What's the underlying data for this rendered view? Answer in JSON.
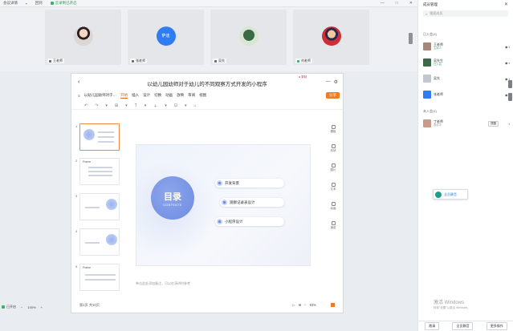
{
  "topbar": {
    "meeting_label": "会议详情",
    "dot": "▪",
    "gallery_label": "回到",
    "recording_label": "云录制已开启"
  },
  "window_controls": [
    "—",
    "□",
    "✕"
  ],
  "participants": [
    {
      "name": "王老师",
      "avatar": "photo"
    },
    {
      "name": "张老师",
      "avatar": "萨迪"
    },
    {
      "name": "吴先",
      "avatar": "plant"
    },
    {
      "name": "刘老师",
      "avatar": "cartoon"
    }
  ],
  "share": {
    "title": "以幼儿园幼师对于幼儿的不同观察方式开发的小程序",
    "rec_indicator": "● 录制",
    "ribbon": {
      "doc_name": "以幼儿园幼师对于…",
      "tabs": [
        "开始",
        "插入",
        "设计",
        "切换",
        "动画",
        "放映",
        "审阅",
        "视图"
      ],
      "active_tab": "开始",
      "share_button": "分享"
    },
    "toolrow": [
      "↶",
      "↷",
      "▾",
      "⊞",
      "▾",
      "T",
      "▾",
      "＋",
      "▾",
      "⊡",
      "▾",
      "⌂"
    ],
    "thumbnails": [
      {
        "num": "1",
        "name": ""
      },
      {
        "num": "2",
        "name": "Frame"
      },
      {
        "num": "3",
        "name": ""
      },
      {
        "num": "4",
        "name": ""
      },
      {
        "num": "5",
        "name": "Frame"
      }
    ],
    "slide": {
      "heading": "目录",
      "subheading": "CONTENTS",
      "items": [
        "开发背景",
        "观察记录表设计",
        "小程序设计"
      ]
    },
    "right_tools": [
      "模板",
      "形状",
      "图片",
      "文本",
      "动画",
      "演讲"
    ],
    "notes_placeholder": "单击此处添加备注，可以在演讲时参考",
    "status": {
      "slide_count": "第1页 共10页",
      "zoom": "93%"
    }
  },
  "bottom_left": {
    "status_label": "已开启",
    "zoom_label": "100%",
    "plus": "+"
  },
  "panel": {
    "title": "成员管理",
    "search_placeholder": "搜索成员",
    "section_online": "已入会(4)",
    "members": [
      {
        "name": "王老师",
        "sub": "主持人",
        "color": "#a7877a"
      },
      {
        "name": "吴先生",
        "sub": "已入会",
        "color": "#3b6b44"
      },
      {
        "name": "吴先",
        "sub": "",
        "color": "#c2c7cf"
      },
      {
        "name": "张老师",
        "sub": "",
        "color": "#2f7df2"
      }
    ],
    "section_pending": "未入会(1)",
    "pending": [
      {
        "name": "丁老师",
        "sub": "邀请中",
        "button": "提醒",
        "color": "#c99a87"
      }
    ],
    "float_button": "全员静音",
    "watermark_line1": "激活 Windows",
    "watermark_line2": "转到\"设置\"以激活 Windows。",
    "bottom_buttons": [
      "邀请",
      "全员静音",
      "更多操作"
    ]
  }
}
